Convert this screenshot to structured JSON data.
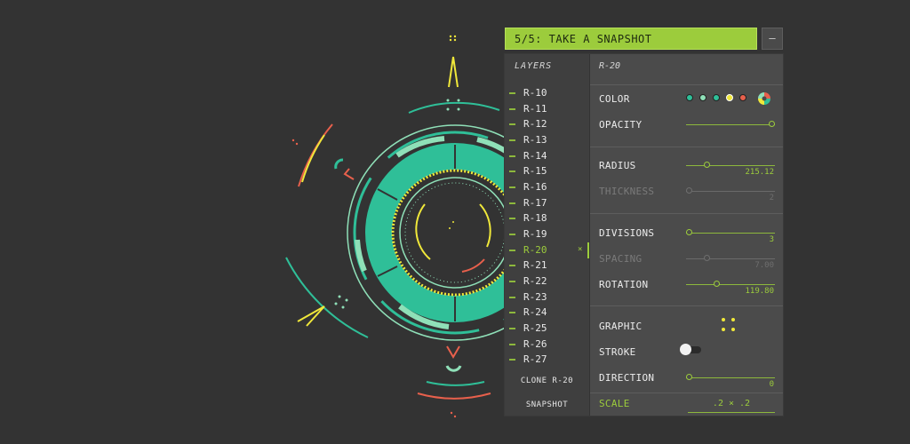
{
  "step": {
    "label": "5/5: TAKE A SNAPSHOT",
    "minimize": "–"
  },
  "layers": {
    "header": "LAYERS",
    "items": [
      "R-10",
      "R-11",
      "R-12",
      "R-13",
      "R-14",
      "R-15",
      "R-16",
      "R-17",
      "R-18",
      "R-19",
      "R-20",
      "R-21",
      "R-22",
      "R-23",
      "R-24",
      "R-25",
      "R-26",
      "R-27"
    ],
    "active": "R-20",
    "close_mark": "×",
    "clone_label": "CLONE R-20",
    "snapshot_label": "SNAPSHOT"
  },
  "props": {
    "title": "R-20",
    "color": {
      "label": "COLOR",
      "swatches": [
        "#2fbf98",
        "#8fe0b8",
        "#2fbf98",
        "#f0e83a",
        "#e8604c"
      ]
    },
    "opacity": {
      "label": "OPACITY",
      "level": 1.0
    },
    "radius": {
      "label": "RADIUS",
      "value": "215.12",
      "level": 0.22
    },
    "thickness": {
      "label": "THICKNESS",
      "value": "2",
      "level": 0.0
    },
    "divisions": {
      "label": "DIVISIONS",
      "value": "3",
      "level": 0.0
    },
    "spacing": {
      "label": "SPACING",
      "value": "7.00",
      "level": 0.22
    },
    "rotation": {
      "label": "ROTATION",
      "value": "119.80",
      "level": 0.33
    },
    "graphic": {
      "label": "GRAPHIC"
    },
    "stroke": {
      "label": "STROKE",
      "on": false
    },
    "direction": {
      "label": "DIRECTION",
      "value": "0",
      "level": 0.0
    },
    "scale": {
      "label": "SCALE",
      "value": ".2 × .2"
    }
  },
  "palette": {
    "accent": "#9ccc3c",
    "teal": "#2fbf98",
    "mint": "#8fe0b8",
    "yellow": "#f0e83a",
    "red": "#e8604c"
  }
}
